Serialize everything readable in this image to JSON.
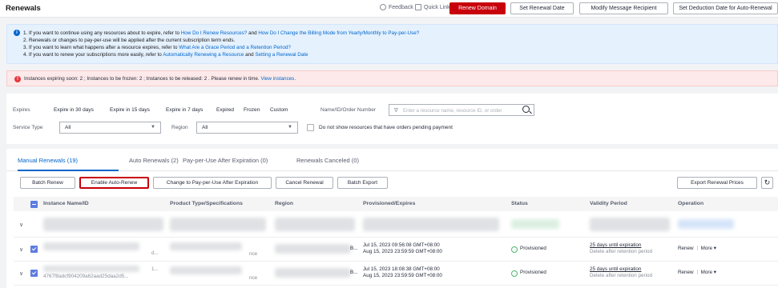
{
  "header": {
    "title": "Renewals",
    "feedback": "Feedback",
    "quick_links": "Quick Links",
    "renew_domain": "Renew Domain",
    "set_renewal_date": "Set Renewal Date",
    "modify_message_recipient": "Modify Message Recipient",
    "set_deduction_date": "Set Deduction Date for Auto-Renewal"
  },
  "info": {
    "l1a": "1. If you want to continue using any resources about to expire, refer to ",
    "l1b": "How Do I Renew Resources?",
    "l1c": " and ",
    "l1d": "How Do I Change the Billing Mode from Yearly/Monthly to Pay-per-Use?",
    "l2": "2. Renewals or changes to pay-per-use will be applied after the current subscription term ends.",
    "l3a": "3. If you want to learn what happens after a resource expires, refer to ",
    "l3b": "What Are a Grace Period and a Retention Period?",
    "l4a": "4. If you want to renew your subscriptions more easily, refer to ",
    "l4b": "Automatically Renewing a Resource",
    "l4c": " and ",
    "l4d": "Setting a Renewal Date"
  },
  "warning": {
    "text": "Instances expiring soon: 2 ; Instances to be frozen: 2 ; Instances to be released: 2 . Please renew in time.",
    "link": "View instances."
  },
  "filters": {
    "expires_label": "Expires",
    "chips": [
      "Expire in 30 days",
      "Expire in 15 days",
      "Expire in 7 days",
      "Expired",
      "Frozen",
      "Custom"
    ],
    "name_label": "Name/ID/Order Number",
    "search_placeholder": "Enter a resource name, resource ID, or order",
    "service_type_label": "Service Type",
    "service_type_value": "All",
    "region_label": "Region",
    "region_value": "All",
    "pending_label": "Do not show resources that have orders pending payment"
  },
  "tabs": [
    "Manual Renewals (19)",
    "Auto Renewals (2)",
    "Pay-per-Use After Expiration (0)",
    "Renewals Canceled (0)"
  ],
  "toolbar": {
    "batch_renew": "Batch Renew",
    "enable_auto_renew": "Enable Auto-Renew",
    "change_ppu": "Change to Pay-per-Use After Expiration",
    "cancel_renewal": "Cancel Renewal",
    "batch_export": "Batch Export",
    "export_prices": "Export Renewal Prices"
  },
  "table": {
    "columns": [
      "Instance Name/ID",
      "Product Type/Specifications",
      "Region",
      "Provisioned/Expires",
      "Status",
      "Validity Period",
      "Operation"
    ],
    "rows": [
      {
        "id_frag": "d...",
        "spec_frag": "nce",
        "region_frag": "B...",
        "provisioned": "Jul 15, 2023 09:56:08 GMT+08:00",
        "expires": "Aug 15, 2023 23:59:59 GMT+08:00",
        "status": "Provisioned",
        "validity": "25 days until expiration",
        "retention": "Delete after retention period",
        "renew": "Renew",
        "more": "More"
      },
      {
        "id_top": "1...",
        "id_frag": "4767f8adcf904209a62aad25daa2d5...",
        "spec_frag": "nce",
        "region_frag": "B...",
        "provisioned": "Jul 15, 2023 18:08:38 GMT+08:00",
        "expires": "Aug 15, 2023 23:59:59 GMT+08:00",
        "status": "Provisioned",
        "validity": "25 days until expiration",
        "retention": "Delete after retention period",
        "renew": "Renew",
        "more": "More"
      }
    ]
  }
}
